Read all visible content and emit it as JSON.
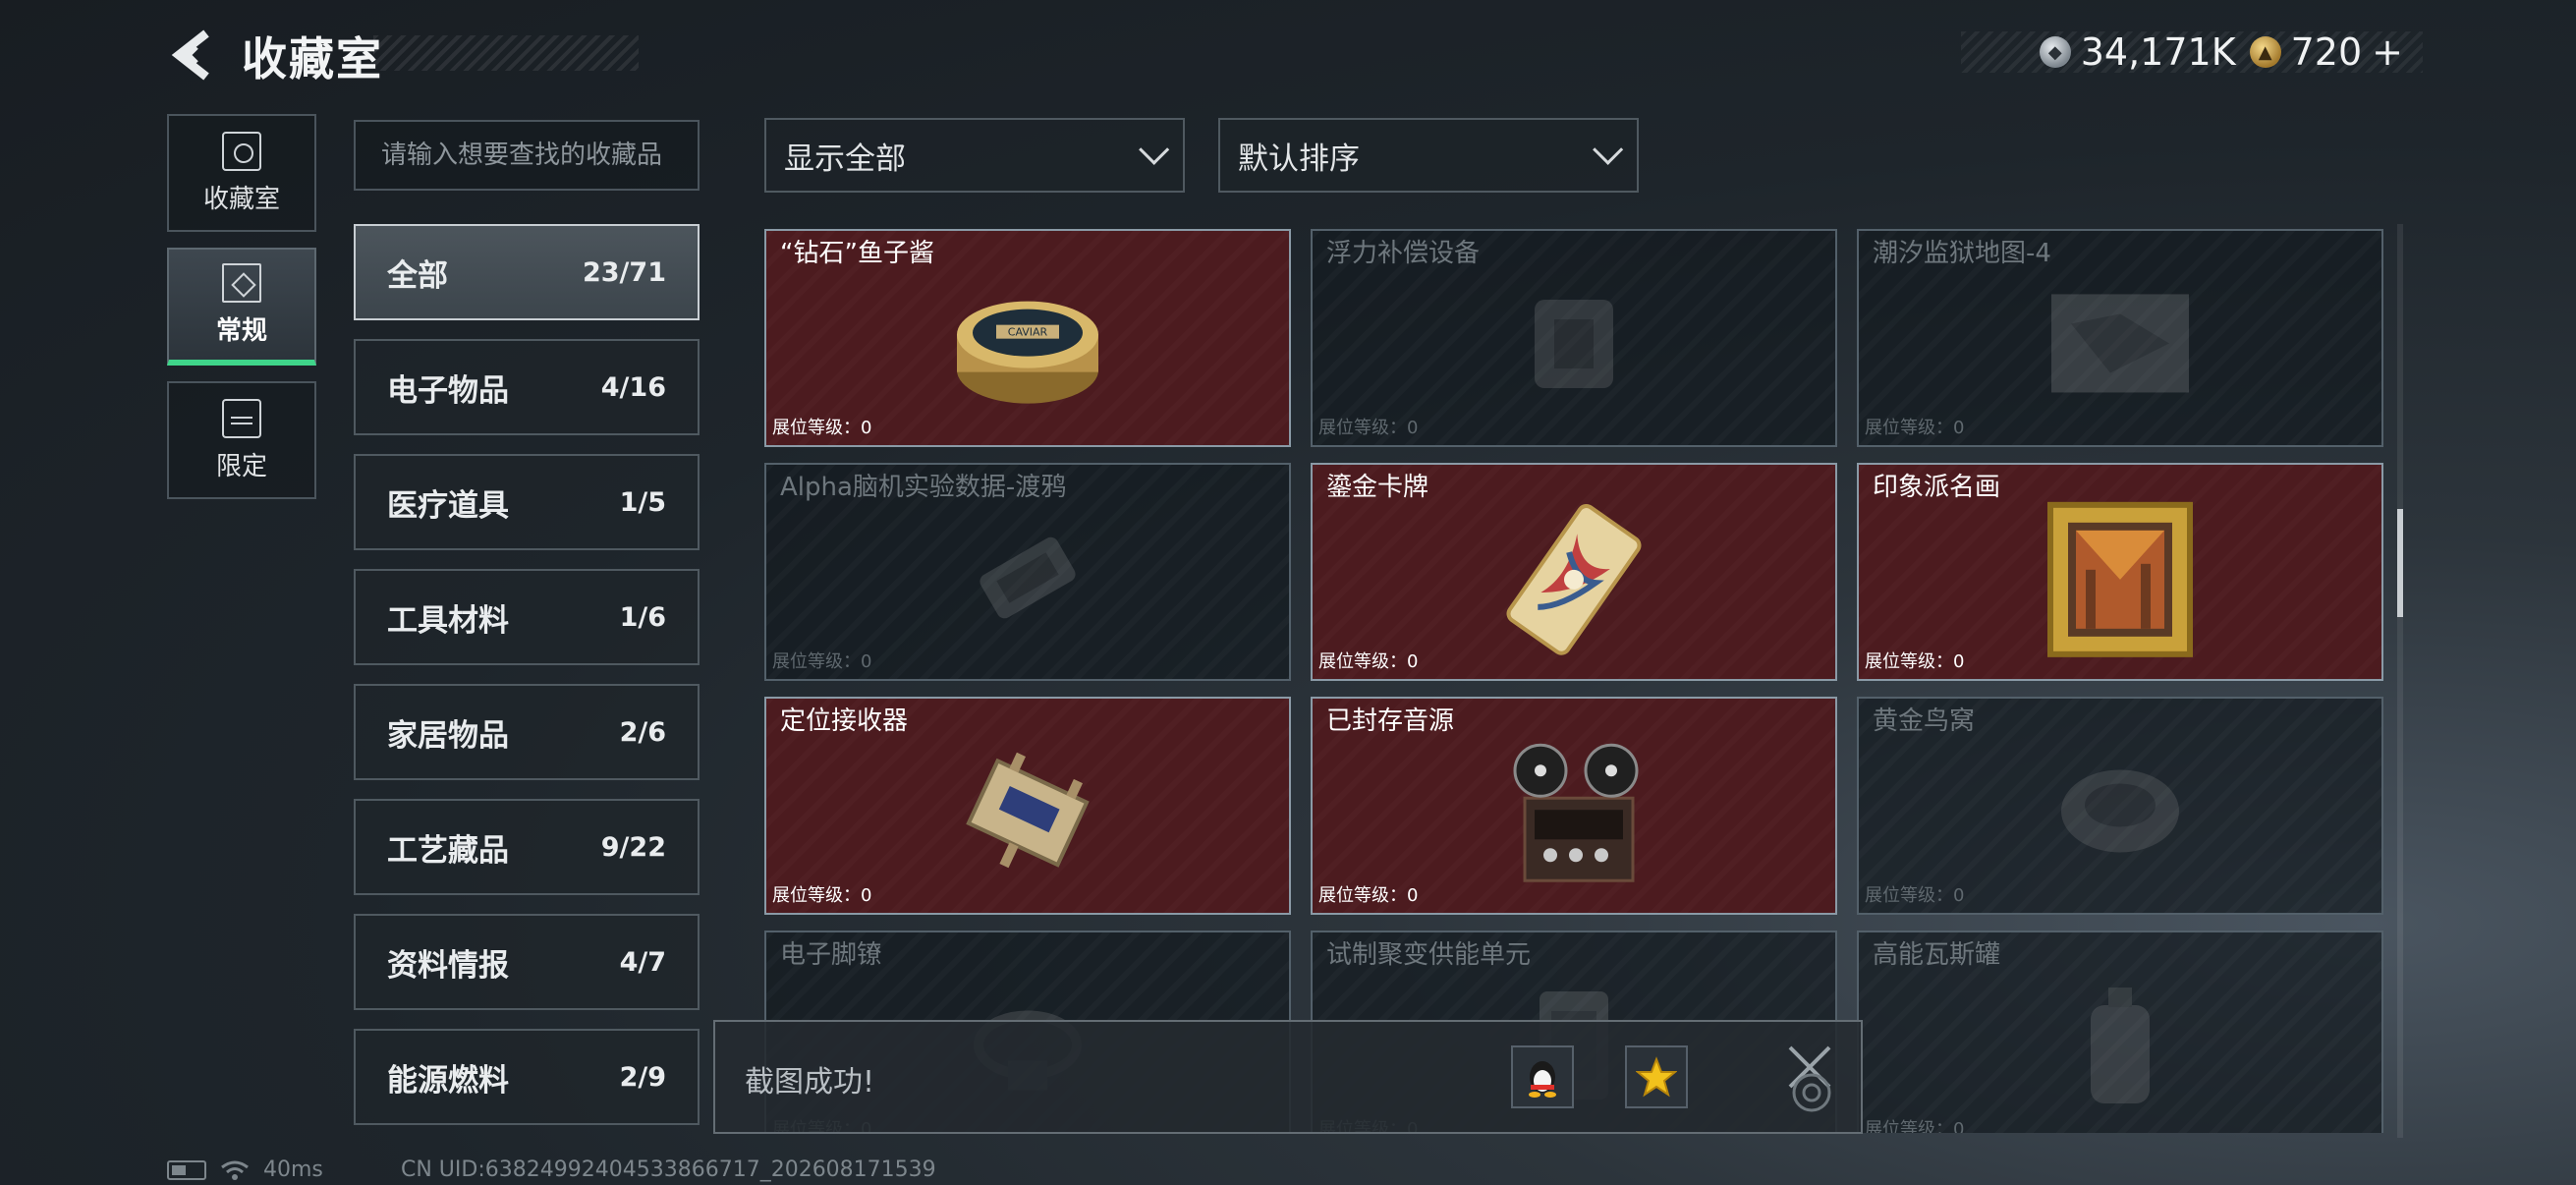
{
  "header": {
    "title": "收藏室"
  },
  "currency": {
    "silver_value": "34,171K",
    "gold_value": "720",
    "gold_add": "+"
  },
  "left_nav": [
    {
      "label": "收藏室",
      "icon": "vault-icon",
      "active": false
    },
    {
      "label": "常规",
      "icon": "document-icon",
      "active": true
    },
    {
      "label": "限定",
      "icon": "limited-icon",
      "active": false
    }
  ],
  "search": {
    "placeholder": "请输入想要查找的收藏品"
  },
  "categories": [
    {
      "name": "全部",
      "count": "23/71",
      "active": true
    },
    {
      "name": "电子物品",
      "count": "4/16"
    },
    {
      "name": "医疗道具",
      "count": "1/5"
    },
    {
      "name": "工具材料",
      "count": "1/6"
    },
    {
      "name": "家居物品",
      "count": "2/6"
    },
    {
      "name": "工艺藏品",
      "count": "9/22"
    },
    {
      "name": "资料情报",
      "count": "4/7"
    },
    {
      "name": "能源燃料",
      "count": "2/9"
    }
  ],
  "filters": {
    "display": "显示全部",
    "sort": "默认排序"
  },
  "level_label": "展位等级：",
  "items": [
    {
      "name": "“钻石”鱼子酱",
      "level": "0",
      "owned": true,
      "icon": "caviar-tin-icon"
    },
    {
      "name": "浮力补偿设备",
      "level": "0",
      "owned": false,
      "icon": "buoyancy-device-icon"
    },
    {
      "name": "潮汐监狱地图-4",
      "level": "0",
      "owned": false,
      "icon": "map-icon"
    },
    {
      "name": "Alpha脑机实验数据-渡鸦",
      "level": "0",
      "owned": false,
      "icon": "data-drive-icon"
    },
    {
      "name": "鎏金卡牌",
      "level": "0",
      "owned": true,
      "icon": "gilded-card-icon"
    },
    {
      "name": "印象派名画",
      "level": "0",
      "owned": true,
      "icon": "painting-icon"
    },
    {
      "name": "定位接收器",
      "level": "0",
      "owned": true,
      "icon": "receiver-icon"
    },
    {
      "name": "已封存音源",
      "level": "0",
      "owned": true,
      "icon": "reel-recorder-icon"
    },
    {
      "name": "黄金鸟窝",
      "level": "0",
      "owned": false,
      "icon": "golden-nest-icon"
    },
    {
      "name": "电子脚镣",
      "level": "0",
      "owned": false,
      "icon": "ankle-monitor-icon"
    },
    {
      "name": "试制聚变供能单元",
      "level": "0",
      "owned": false,
      "icon": "fusion-cell-icon"
    },
    {
      "name": "高能瓦斯罐",
      "level": "0",
      "owned": false,
      "icon": "gas-canister-icon"
    }
  ],
  "toast": {
    "message": "截图成功!"
  },
  "status": {
    "ping": "40ms",
    "uid": "CN UID:63824992404533866717_202608171539"
  },
  "colors": {
    "owned_bg": "#4c1b1f",
    "active_tab_accent": "#3fd58a"
  }
}
